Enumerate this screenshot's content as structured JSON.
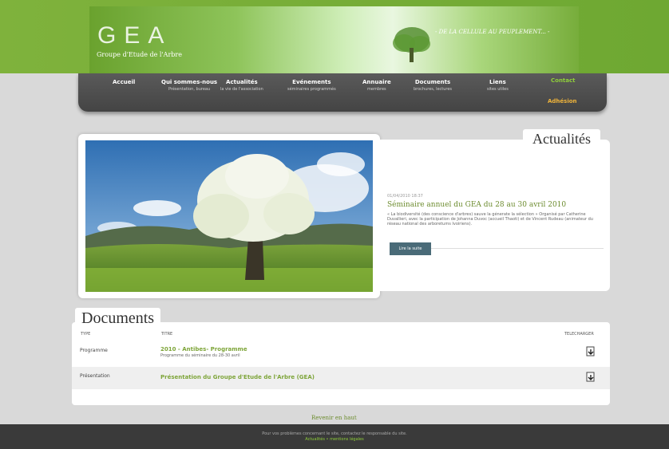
{
  "header": {
    "logo_title": "GEA",
    "logo_subtitle": "Groupe d'Etude de l'Arbre",
    "slogan": "- DE LA CELLULE AU PEUPLEMENT... -"
  },
  "nav": {
    "items": [
      {
        "label": "Accueil",
        "sub": ""
      },
      {
        "label": "Qui sommes-nous",
        "sub": "Présentation, bureau"
      },
      {
        "label": "Actualités",
        "sub": "la vie de l'association"
      },
      {
        "label": "Evénements",
        "sub": "séminaires programmés"
      },
      {
        "label": "Annuaire",
        "sub": "membres"
      },
      {
        "label": "Documents",
        "sub": "brochures, lectures"
      },
      {
        "label": "Liens",
        "sub": "sites utiles"
      }
    ],
    "contact": "Contact",
    "adhesion": "Adhésion"
  },
  "news": {
    "heading": "Actualités",
    "date": "01/04/2010 18:37",
    "title": "Séminaire annuel du GEA du 28 au 30 avril 2010",
    "text": "« La biodiversité (des conscience d'arbres) sauve la génerate la sélection » Organisé par Catherine Duvallieri, avec la participation de Johanna Duvoc (accueil Thaoti) et de Vincent Rudeau (animateur du réseau national des arboretums Ivoiriens).",
    "button": "Lire la suite"
  },
  "documents": {
    "heading": "Documents",
    "col_type": "TYPE",
    "col_title": "TITRE",
    "col_download": "TELECHARGER",
    "rows": [
      {
        "type": "Programme",
        "title": "2010 - Antibes- Programme",
        "sub": "Programme du séminaire du 28-30 avril"
      },
      {
        "type": "Présentation",
        "title": "Présentation du Groupe d'Etude de l'Arbre (GEA)",
        "sub": ""
      }
    ]
  },
  "back_to_top": "Revenir en haut",
  "footer": {
    "line1": "Pour vos problèmes concernant le site, contactez le responsable du site.",
    "line2": "Actualités • mentions légales"
  },
  "colors": {
    "brand_green": "#7fb23c",
    "accent_green": "#7ea53a",
    "nav_dark": "#4c4c4c",
    "adhesion_orange": "#f0b43a"
  }
}
